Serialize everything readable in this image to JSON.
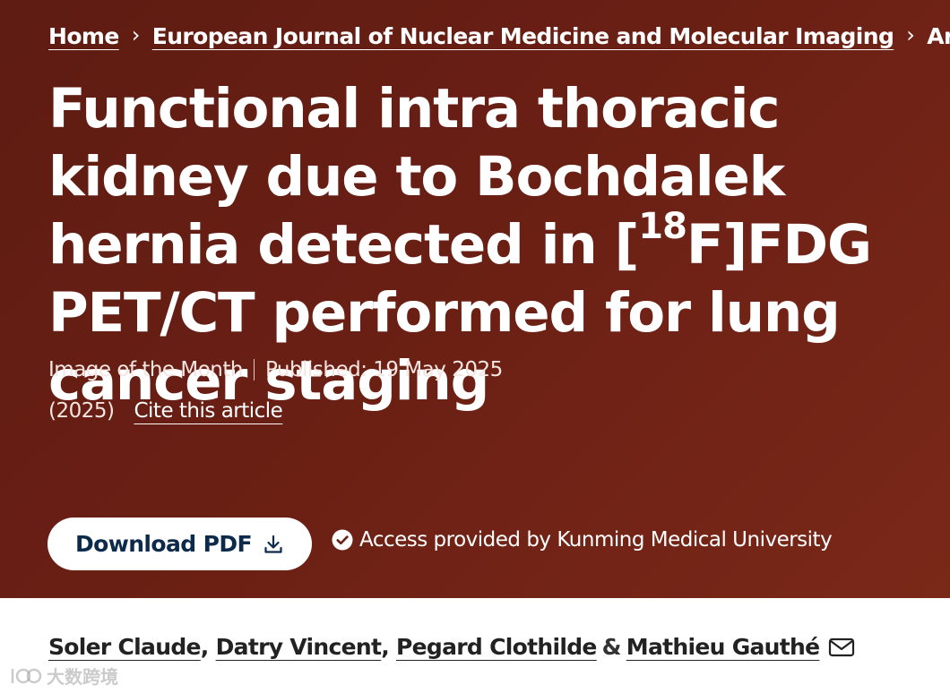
{
  "breadcrumb": {
    "items": [
      {
        "label": "Home"
      },
      {
        "label": "European Journal of Nuclear Medicine and Molecular Imaging"
      }
    ],
    "current": "Article",
    "separator": "›"
  },
  "article": {
    "title_part1": "Functional intra thoracic kidney due to Bochdalek hernia detected in [",
    "title_sup": "18",
    "title_part2": "F]FDG PET/CT performed for lung cancer staging",
    "type": "Image of the Month",
    "published": "Published: 19 May 2025",
    "year": "(2025)",
    "cite_label": "Cite this article"
  },
  "actions": {
    "download_label": "Download PDF",
    "access_text": "Access provided by Kunming Medical University"
  },
  "authors": {
    "list": [
      "Soler Claude",
      "Datry Vincent",
      "Pegard Clothilde",
      "Mathieu Gauthé"
    ],
    "comma": ",",
    "amp": "&"
  },
  "watermark": {
    "text": "大数跨境"
  },
  "colors": {
    "hero_bg": "#6a1f14",
    "button_text": "#0c2a4a",
    "author_text": "#222222"
  },
  "icons": {
    "download": "download-icon",
    "access": "check-circle-icon",
    "mail": "envelope-icon",
    "separator": "chevron-right-icon"
  }
}
